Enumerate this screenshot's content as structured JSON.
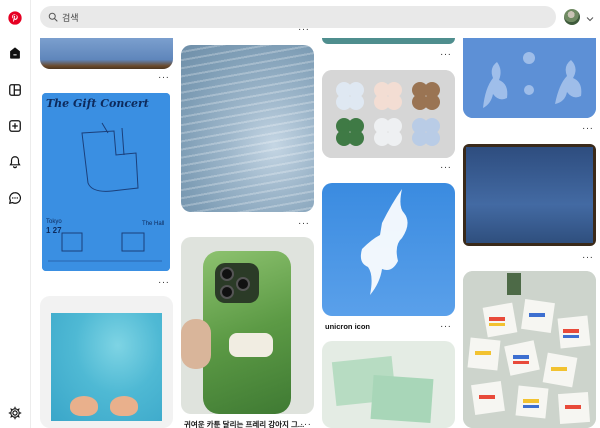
{
  "search": {
    "placeholder": "검색"
  },
  "pins": [
    {
      "caption": ""
    },
    {
      "caption": ""
    },
    {
      "caption": ""
    },
    {
      "caption": ""
    },
    {
      "caption": ""
    },
    {
      "caption": "귀여운 카툰 달리는 프레리 강아지 그..."
    },
    {
      "caption": ""
    },
    {
      "caption": ""
    },
    {
      "caption": "unicron icon"
    },
    {
      "caption": ""
    },
    {
      "caption": ""
    },
    {
      "caption": ""
    }
  ],
  "poster": {
    "title": "The Gift Concert",
    "date_line1": "Tokyo",
    "date_line2": "1 27",
    "fine_print": "The Hall"
  },
  "colors": {
    "accent": "#e60023",
    "search_bg": "#e9e9e9"
  },
  "icons": [
    "pinterest-logo-icon",
    "home-icon",
    "explore-icon",
    "create-icon",
    "notifications-icon",
    "messages-icon",
    "settings-icon",
    "search-icon",
    "chevron-down-icon"
  ]
}
